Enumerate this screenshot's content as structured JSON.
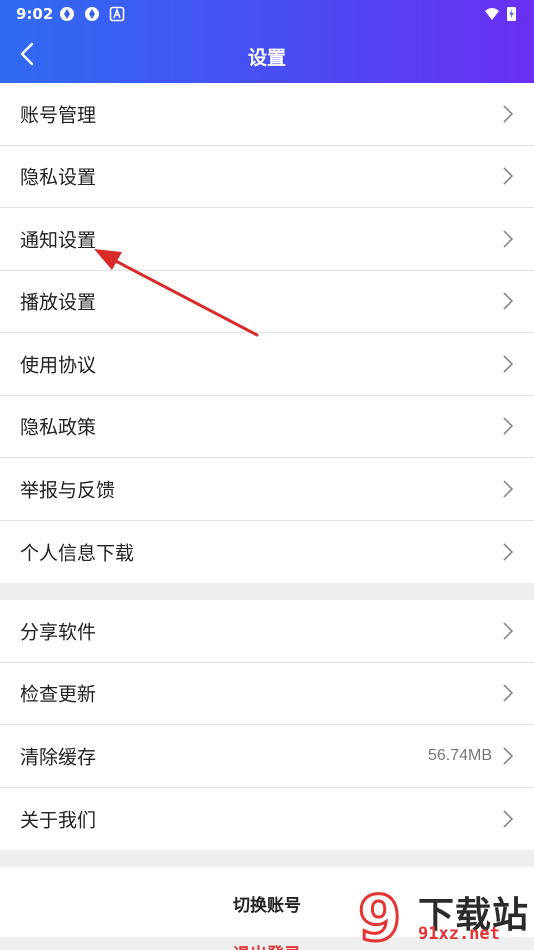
{
  "status_bar": {
    "time": "9:02"
  },
  "header": {
    "title": "设置"
  },
  "group1": [
    {
      "label": "账号管理"
    },
    {
      "label": "隐私设置"
    },
    {
      "label": "通知设置"
    },
    {
      "label": "播放设置"
    },
    {
      "label": "使用协议"
    },
    {
      "label": "隐私政策"
    },
    {
      "label": "举报与反馈"
    },
    {
      "label": "个人信息下载"
    }
  ],
  "group2": [
    {
      "label": "分享软件"
    },
    {
      "label": "检查更新"
    },
    {
      "label": "清除缓存",
      "value": "56.74MB"
    },
    {
      "label": "关于我们"
    }
  ],
  "actions": {
    "switch_account": "切换账号",
    "logout": "退出登录"
  },
  "watermark": {
    "brand": "下载站",
    "url": "91xz.net",
    "logo_glyph": "9"
  },
  "colors": {
    "header_start": "#2f6bf2",
    "header_end": "#6a2ff2",
    "annotation_arrow": "#d92a2a",
    "logout": "#e53333"
  }
}
